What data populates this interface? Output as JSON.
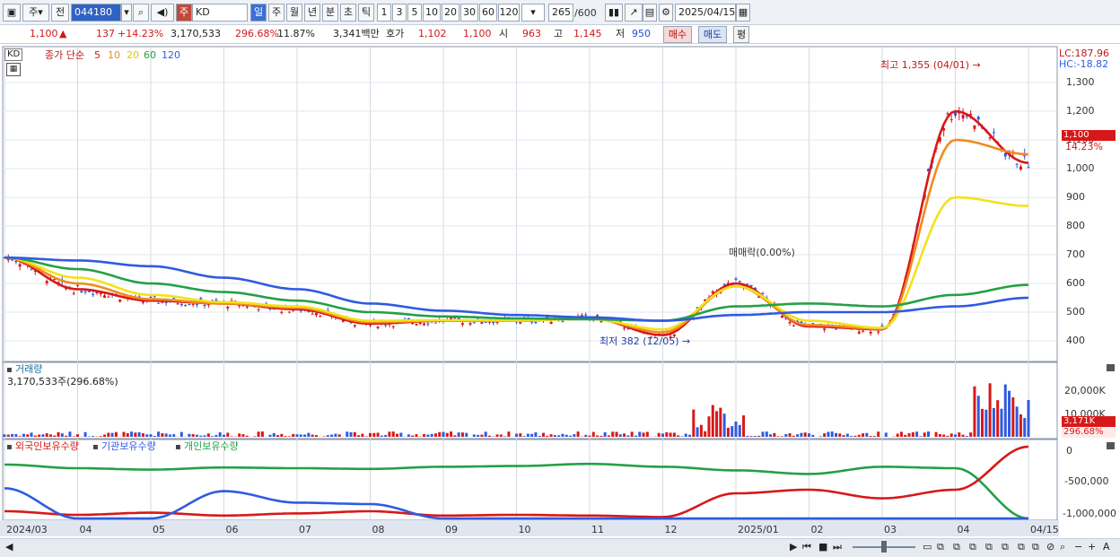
{
  "toolbar": {
    "type_label": "주",
    "market_label": "전",
    "code_value": "044180",
    "name_prefix": "주",
    "name_value": "KD",
    "periods": [
      "일",
      "주",
      "월",
      "년",
      "분",
      "초",
      "틱"
    ],
    "intervals": [
      "1",
      "3",
      "5",
      "10",
      "20",
      "30",
      "60",
      "120"
    ],
    "count_value": "265",
    "count_max": "/600",
    "date_value": "2025/04/15"
  },
  "quote": {
    "price": "1,100",
    "up_arrow": "▲",
    "change": "137",
    "change_pct": "+14.23%",
    "volume": "3,170,533",
    "vol_ratio": "296.68%",
    "turnover": "11.87%",
    "amount": "3,341백만",
    "hoga_label": "호가",
    "ask": "1,102",
    "bid": "1,100",
    "open_label": "시",
    "open": "963",
    "high_label": "고",
    "high": "1,145",
    "low_label": "저",
    "low": "950",
    "buy_label": "매수",
    "sell_label": "매도",
    "eval_label": "평"
  },
  "price_panel": {
    "ticker_badge": "KD",
    "ma_title": "종가 단순",
    "ma_periods": [
      "5",
      "10",
      "20",
      "60",
      "120"
    ],
    "ma_colors": [
      "#d81818",
      "#f28a1e",
      "#f2e21a",
      "#24a046",
      "#2f5be0"
    ],
    "lc_label": "LC:187.96",
    "hc_label": "HC:-18.82",
    "y_ticks": [
      "1,300",
      "1,200",
      "1,100",
      "1,000",
      "900",
      "800",
      "700",
      "600",
      "500",
      "400"
    ],
    "last_price_tag": "1,100",
    "last_pct_tag": "14.23%",
    "high_note": "최고 1,355 (04/01) →",
    "low_note": "최저 382 (12/05) →",
    "event_note": "매매락(0.00%)"
  },
  "volume_panel": {
    "title": "거래량",
    "value_text": "3,170,533주(296.68%)",
    "y_ticks": [
      "20,000K",
      "10,000K"
    ],
    "last_tag": "3,171K",
    "last_pct_tag": "296.68%"
  },
  "holding_panel": {
    "series": [
      {
        "name": "외국인보유수량",
        "color": "#d81818"
      },
      {
        "name": "기관보유수량",
        "color": "#2f5be0"
      },
      {
        "name": "개인보유수량",
        "color": "#24a046"
      }
    ],
    "y_ticks": [
      "0",
      "-500,000",
      "-1,000,000"
    ]
  },
  "x_axis": {
    "labels": [
      "2024/03",
      "04",
      "05",
      "06",
      "07",
      "08",
      "09",
      "10",
      "11",
      "12",
      "2025/01",
      "02",
      "03",
      "04",
      "04/15"
    ]
  },
  "chart_data": {
    "type": "line",
    "x": [
      "2024/03",
      "2024/04",
      "2024/05",
      "2024/06",
      "2024/07",
      "2024/08",
      "2024/09",
      "2024/10",
      "2024/11",
      "2024/12",
      "2025/01",
      "2025/02",
      "2025/03",
      "2025/04",
      "2025/04/15"
    ],
    "series": [
      {
        "name": "5",
        "values": [
          690,
          580,
          540,
          530,
          510,
          460,
          470,
          470,
          480,
          420,
          600,
          450,
          440,
          1200,
          1020
        ]
      },
      {
        "name": "10",
        "values": [
          690,
          600,
          545,
          530,
          515,
          465,
          470,
          470,
          478,
          430,
          590,
          455,
          442,
          1100,
          1050
        ]
      },
      {
        "name": "20",
        "values": [
          690,
          620,
          560,
          535,
          520,
          470,
          472,
          471,
          476,
          440,
          590,
          470,
          445,
          900,
          870
        ]
      },
      {
        "name": "60",
        "values": [
          690,
          650,
          600,
          570,
          540,
          500,
          485,
          478,
          475,
          470,
          520,
          530,
          520,
          560,
          595
        ]
      },
      {
        "name": "120",
        "values": [
          690,
          680,
          660,
          620,
          580,
          530,
          505,
          490,
          482,
          470,
          490,
          500,
          500,
          520,
          550
        ]
      }
    ],
    "price_high": 1355,
    "price_low": 382,
    "last": 1100,
    "ylim": [
      350,
      1400
    ],
    "volume_ylim": [
      0,
      25000
    ],
    "holding_ylim": [
      -1000000,
      0
    ]
  }
}
